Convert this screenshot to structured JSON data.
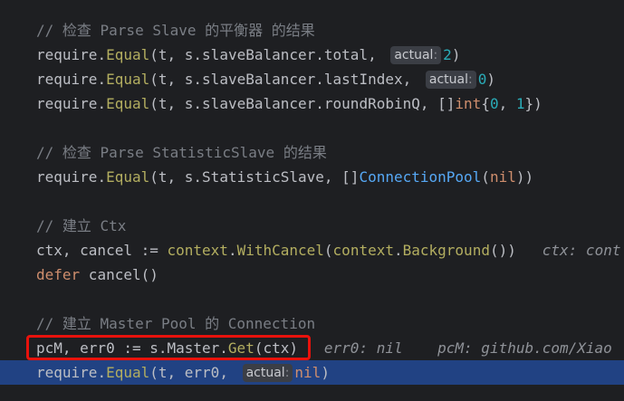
{
  "lines": {
    "c1": "// 检查 Parse Slave 的平衡器 的结果",
    "l1": {
      "pkg": "require",
      "fn": "Equal",
      "args": "(t, s.slaveBalancer.total, ",
      "hint": "actual",
      "val": "2",
      "end": ")"
    },
    "l2": {
      "pkg": "require",
      "fn": "Equal",
      "args": "(t, s.slaveBalancer.lastIndex, ",
      "hint": "actual",
      "val": "0",
      "end": ")"
    },
    "l3": {
      "pkg": "require",
      "fn": "Equal",
      "args": "(t, s.slaveBalancer.roundRobinQ, []",
      "type": "int",
      "brace_open": "{",
      "n0": "0",
      "comma": ", ",
      "n1": "1",
      "end": "})"
    },
    "c2": "// 检查 Parse StatisticSlave 的结果",
    "l4": {
      "pkg": "require",
      "fn": "Equal",
      "args": "(t, s.StatisticSlave, []",
      "type": "ConnectionPool",
      "open": "(",
      "nil": "nil",
      "end": "))"
    },
    "c3": "// 建立 Ctx",
    "l5": {
      "lhs": "ctx, cancel := ",
      "pkg": "context",
      "fn": "WithCancel",
      "open": "(",
      "pkg2": "context",
      "fn2": "Background",
      "end": "())",
      "inlay": "ctx: cont"
    },
    "l6": {
      "kw": "defer",
      "rest": " cancel()"
    },
    "c4": "// 建立 Master Pool 的 Connection",
    "l7": {
      "lhs": "pcM, err0 := s.Master.",
      "fn": "Get",
      "end": "(ctx)",
      "inlay1": "err0: nil",
      "inlay2": "pcM: github.com/Xiao"
    },
    "l8": {
      "pkg": "require",
      "fn": "Equal",
      "args": "(t, err0, ",
      "hint": "actual",
      "nil": "nil",
      "end": ")"
    }
  },
  "hint_colon": ":"
}
